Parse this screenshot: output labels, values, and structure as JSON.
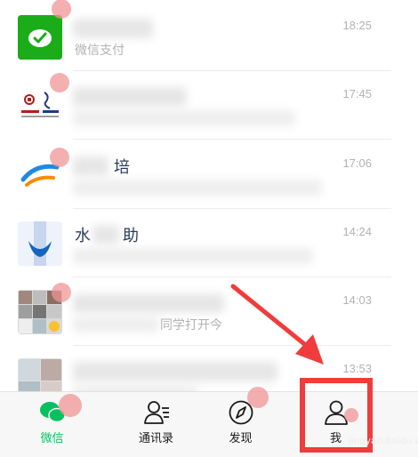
{
  "colors": {
    "accent": "#07c160",
    "highlight": "#f03c3c",
    "time": "#b2b2b2"
  },
  "chats": [
    {
      "name": "",
      "preview": "微信支付",
      "time": "18:25",
      "avatar_icon": "wechat-pay-icon"
    },
    {
      "name": "",
      "preview": "",
      "time": "17:45",
      "avatar_icon": "bank-logo-icon"
    },
    {
      "name": "培",
      "preview": "",
      "time": "17:06",
      "avatar_icon": "training-logo-icon"
    },
    {
      "name": "水",
      "name2": "助",
      "preview": "",
      "time": "14:24",
      "avatar_icon": "water-assistant-icon"
    },
    {
      "name": "",
      "preview": "同学打开今",
      "time": "14:03",
      "avatar_icon": "group-avatar-icon"
    },
    {
      "name": "",
      "preview": "",
      "time": "13:53",
      "avatar_icon": "group-avatar-icon"
    }
  ],
  "tabbar": {
    "tabs": [
      {
        "label": "微信",
        "icon": "chat-bubbles-icon",
        "active": true
      },
      {
        "label": "通讯录",
        "icon": "contacts-icon",
        "active": false
      },
      {
        "label": "发现",
        "icon": "compass-icon",
        "active": false
      },
      {
        "label": "我",
        "icon": "person-icon",
        "active": false
      }
    ]
  },
  "watermark": "jingyan.baidu.com"
}
